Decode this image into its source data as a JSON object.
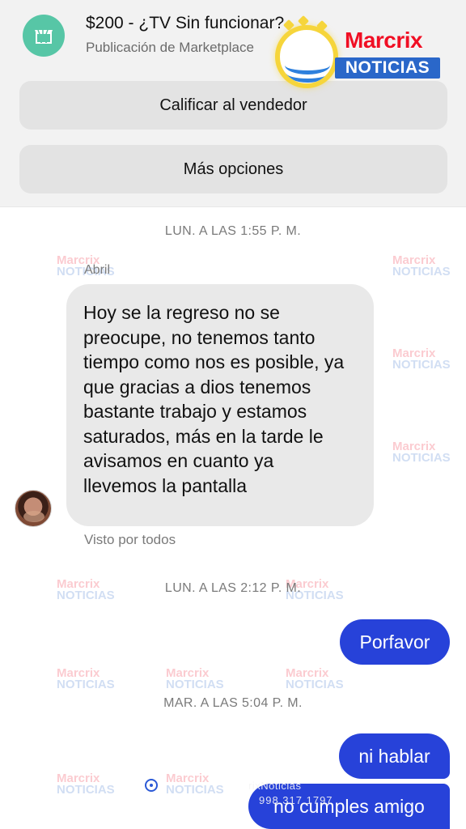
{
  "header": {
    "listing_title": "$200 - ¿TV Sin funcionar?",
    "listing_subtitle": "Publicación de Marketplace",
    "marketplace_icon": "storefront-icon"
  },
  "action_sheet": {
    "rate_seller": "Calificar al vendedor",
    "more_options": "Más opciones"
  },
  "watermark": {
    "brand_top": "Marcrix",
    "brand_bottom": "NOTICIAS",
    "tile_top": "Marcrix",
    "tile_bottom": "NOTICIAS",
    "footer_text": "rixNoticias",
    "footer_phone": "998 317 1797"
  },
  "messages": {
    "timestamp_1": "LUN. A LAS 1:55 P. M.",
    "sender_name": "Abril",
    "incoming_text": "Hoy se la regreso no se preocupe, no tenemos tanto tiempo como nos es posible, ya que gracias a dios tenemos bastante trabajo y estamos saturados, más en la tarde le avisamos en cuanto ya llevemos la pantalla",
    "seen_status": "Visto por todos",
    "timestamp_2": "LUN. A LAS 2:12 P. M.",
    "outgoing_1": "Porfavor",
    "timestamp_3": "MAR. A LAS 5:04 P. M.",
    "outgoing_2": "ni hablar",
    "outgoing_3": "no cumples amigo"
  },
  "colors": {
    "header_background": "#f2f2f2",
    "marketplace_icon": "#57c6a6",
    "incoming_bubble": "#e9e9e9",
    "outgoing_bubble": "#2742d9",
    "watermark_red": "#f00f24",
    "watermark_blue": "#2a67c9",
    "watermark_yellow": "#f6d53b"
  }
}
